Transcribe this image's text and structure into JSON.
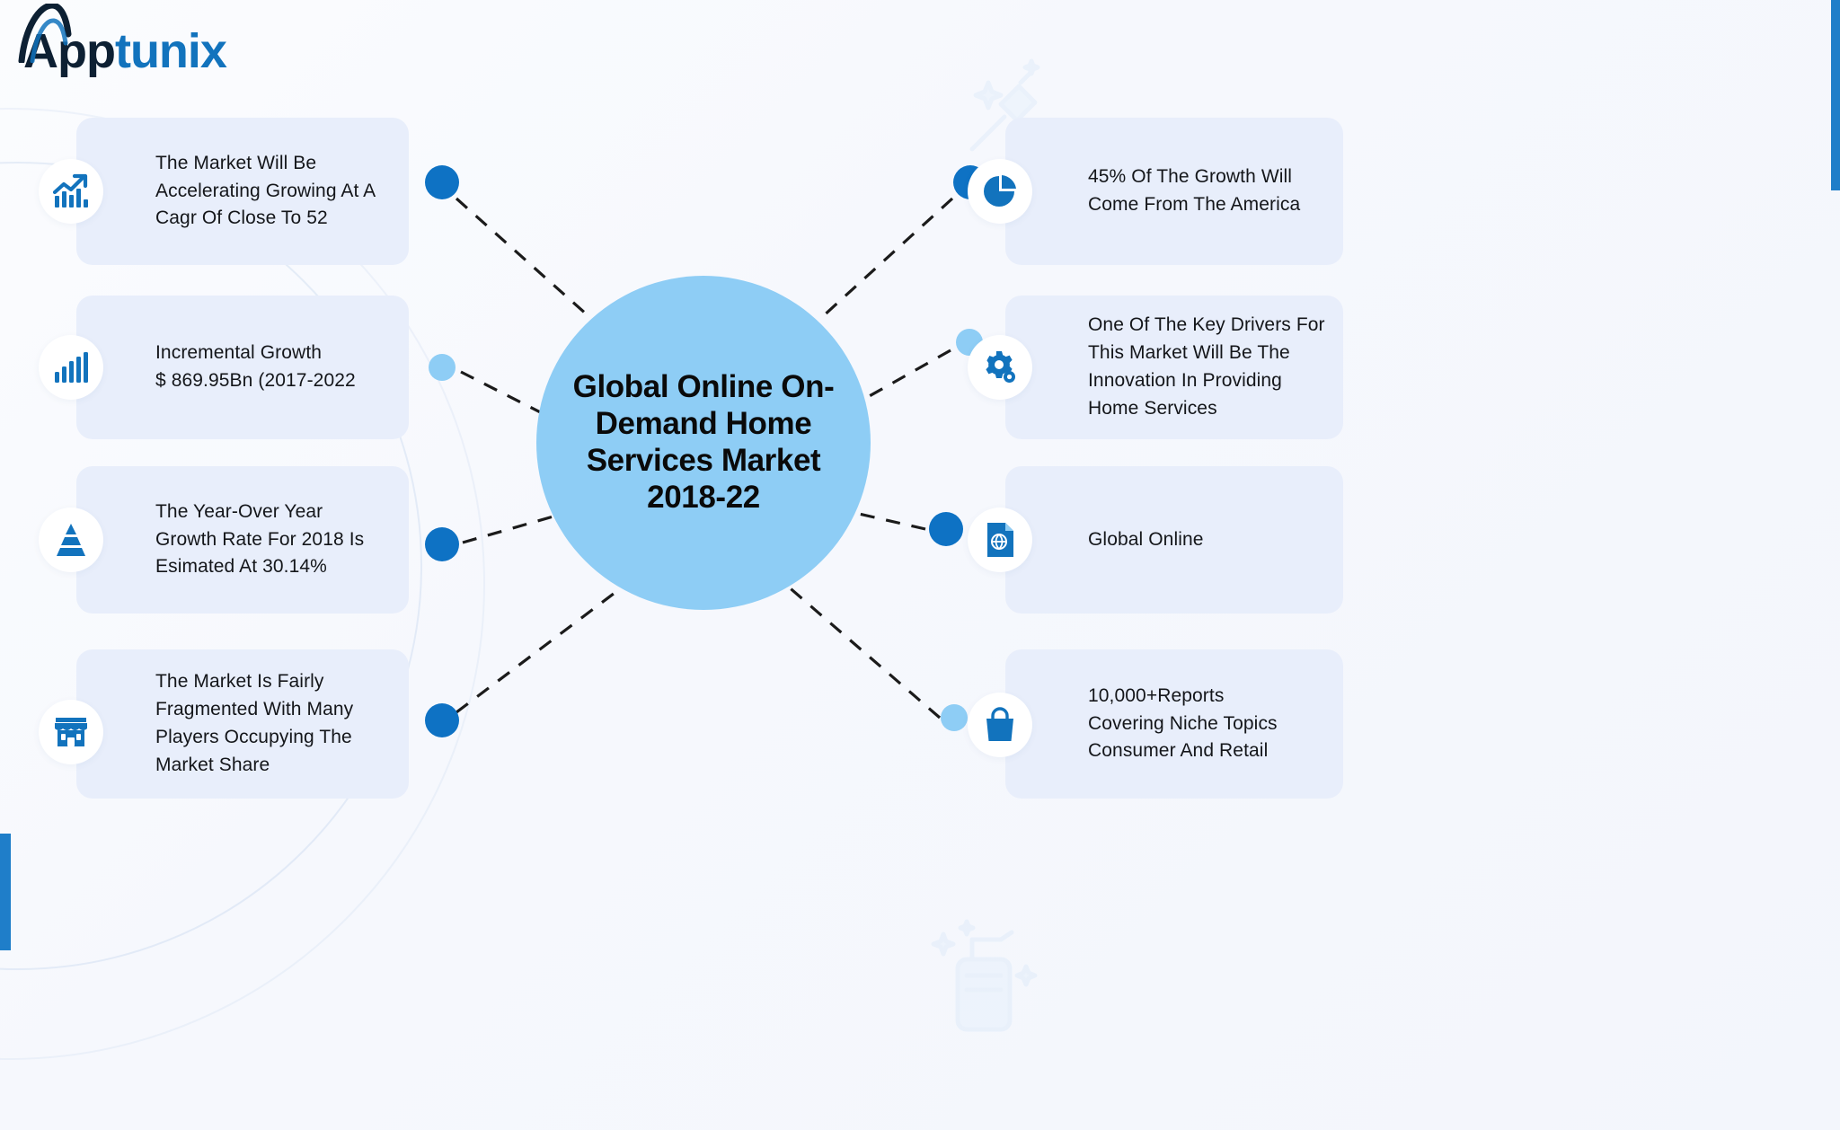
{
  "brand": {
    "logo_app": "App",
    "logo_tunix": "tunix",
    "logo_icon": "apptunix-arc-logo"
  },
  "colors": {
    "accent_dark_blue": "#0e72c4",
    "accent_light_blue": "#8ecdf5",
    "card_background": "#e8eefb",
    "page_background": "#f6f8fd",
    "logo_navy": "#0d2033",
    "text_dark": "#14161a"
  },
  "center": {
    "title": "Global Online On-Demand Home Services Market 2018-22",
    "shape": "circle"
  },
  "left_cards": [
    {
      "text": "The Market Will Be\nAccelerating Growing At A\nCagr Of Close To 52",
      "icon": "trending-up-chart-icon"
    },
    {
      "text": "Incremental Growth\n$ 869.95Bn (2017-2022",
      "icon": "bar-chart-icon"
    },
    {
      "text": "The Year-Over Year\nGrowth Rate For 2018 Is\nEsimated At 30.14%",
      "icon": "pyramid-icon"
    },
    {
      "text": "The Market Is Fairly\nFragmented With Many\nPlayers Occupying The\nMarket Share",
      "icon": "storefront-icon"
    }
  ],
  "right_cards": [
    {
      "text": "45% Of The Growth Will\nCome From The America",
      "icon": "pie-chart-icon"
    },
    {
      "text": "One Of The Key Drivers For\nThis Market Will Be The\nInnovation In Providing\nHome Services",
      "icon": "gear-icon"
    },
    {
      "text": "Global Online",
      "icon": "document-globe-icon"
    },
    {
      "text": "10,000+Reports\nCovering Niche Topics\nConsumer And Retail",
      "icon": "shopping-bag-icon"
    }
  ],
  "connector_dots": [
    {
      "side": "left",
      "size": "big",
      "color": "#0e72c4"
    },
    {
      "side": "left",
      "size": "small",
      "color": "#8ecdf5"
    },
    {
      "side": "left",
      "size": "big",
      "color": "#0e72c4"
    },
    {
      "side": "left",
      "size": "big",
      "color": "#0e72c4"
    },
    {
      "side": "right",
      "size": "big",
      "color": "#0e72c4"
    },
    {
      "side": "right",
      "size": "small",
      "color": "#8ecdf5"
    },
    {
      "side": "right",
      "size": "big",
      "color": "#0e72c4"
    },
    {
      "side": "right",
      "size": "small",
      "color": "#8ecdf5"
    }
  ],
  "watermarks": [
    {
      "icon": "squeegee-sparkle-watermark",
      "position": "top-center"
    },
    {
      "icon": "spray-bottle-sparkle-watermark",
      "position": "bottom-center"
    }
  ]
}
